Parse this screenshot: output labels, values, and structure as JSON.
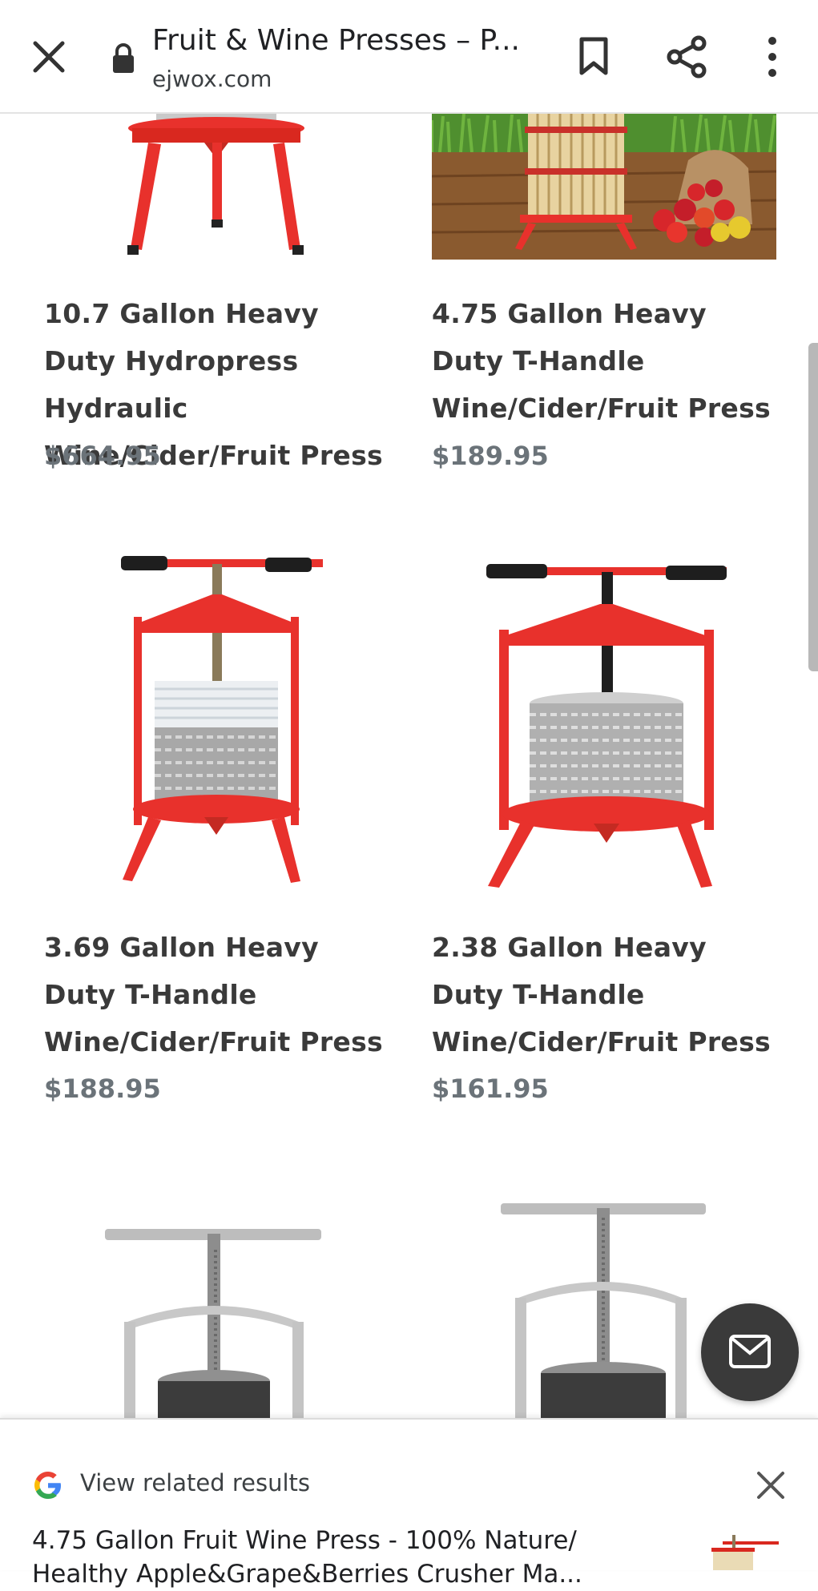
{
  "browser": {
    "title": "Fruit & Wine Presses – P...",
    "domain": "ejwox.com"
  },
  "products": [
    {
      "name": "10.7 Gallon Heavy Duty Hydropress Hydraulic Wine/Cider/Fruit Press",
      "price": "$664.95"
    },
    {
      "name": "4.75 Gallon Heavy Duty T-Handle Wine/Cider/Fruit Press",
      "price": "$189.95"
    },
    {
      "name": "3.69 Gallon Heavy Duty T-Handle Wine/Cider/Fruit Press",
      "price": "$188.95"
    },
    {
      "name": "2.38 Gallon Heavy Duty T-Handle Wine/Cider/Fruit Press",
      "price": "$161.95"
    }
  ],
  "related": {
    "label": "View related results",
    "result_text": "4.75 Gallon Fruit Wine Press - 100% Nature/ Healthy Apple&Grape&Berries Crusher Ma..."
  },
  "icons": [
    "close-icon",
    "lock-icon",
    "bookmark-icon",
    "share-icon",
    "more-vert-icon",
    "mail-icon",
    "google-g-icon"
  ],
  "colors": {
    "press_red": "#e8312c",
    "price_gray": "#6b7379",
    "fab": "#3a3a3a"
  }
}
